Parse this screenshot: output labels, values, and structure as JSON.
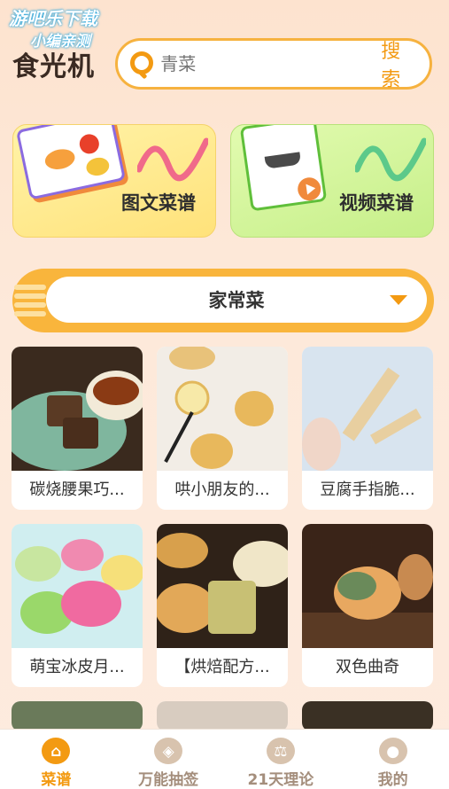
{
  "watermark": {
    "line1": "游吧乐下载",
    "line2": "小编亲测"
  },
  "app_logo": "食光机",
  "search": {
    "placeholder": "青菜",
    "button_label": "搜索"
  },
  "feature_cards": [
    {
      "label": "图文菜谱",
      "icon": "recipe-book-icon"
    },
    {
      "label": "视频菜谱",
      "icon": "video-notebook-icon"
    }
  ],
  "category": {
    "selected": "家常菜"
  },
  "recipes": [
    {
      "name": "碳烧腰果巧...",
      "photo_colors": [
        "#3a2a1e",
        "#7fb69e",
        "#c5a07a"
      ]
    },
    {
      "name": "哄小朋友的...",
      "photo_colors": [
        "#f2ede6",
        "#e8b85c",
        "#222"
      ]
    },
    {
      "name": "豆腐手指脆...",
      "photo_colors": [
        "#d8e4ef",
        "#e8cfa0",
        "#f0d6c8"
      ]
    },
    {
      "name": "萌宝冰皮月...",
      "photo_colors": [
        "#d0eef0",
        "#f06aa0",
        "#9ad86a"
      ]
    },
    {
      "name": "【烘焙配方...",
      "photo_colors": [
        "#2f2218",
        "#d8a04c",
        "#f0e6c8"
      ]
    },
    {
      "name": "双色曲奇",
      "photo_colors": [
        "#3a2418",
        "#e8a860",
        "#6a8a5a"
      ]
    }
  ],
  "bottom_nav": [
    {
      "label": "菜谱",
      "icon": "dish-cover-icon",
      "glyph": "⌂",
      "active": true
    },
    {
      "label": "万能抽签",
      "icon": "tag-icon",
      "glyph": "◈",
      "active": false
    },
    {
      "label": "21天理论",
      "icon": "balance-icon",
      "glyph": "⚖",
      "active": false
    },
    {
      "label": "我的",
      "icon": "user-icon",
      "glyph": "●",
      "active": false
    }
  ],
  "colors": {
    "accent": "#f39a12",
    "background": "#fde6d6",
    "category_bar": "#f9b53c"
  }
}
